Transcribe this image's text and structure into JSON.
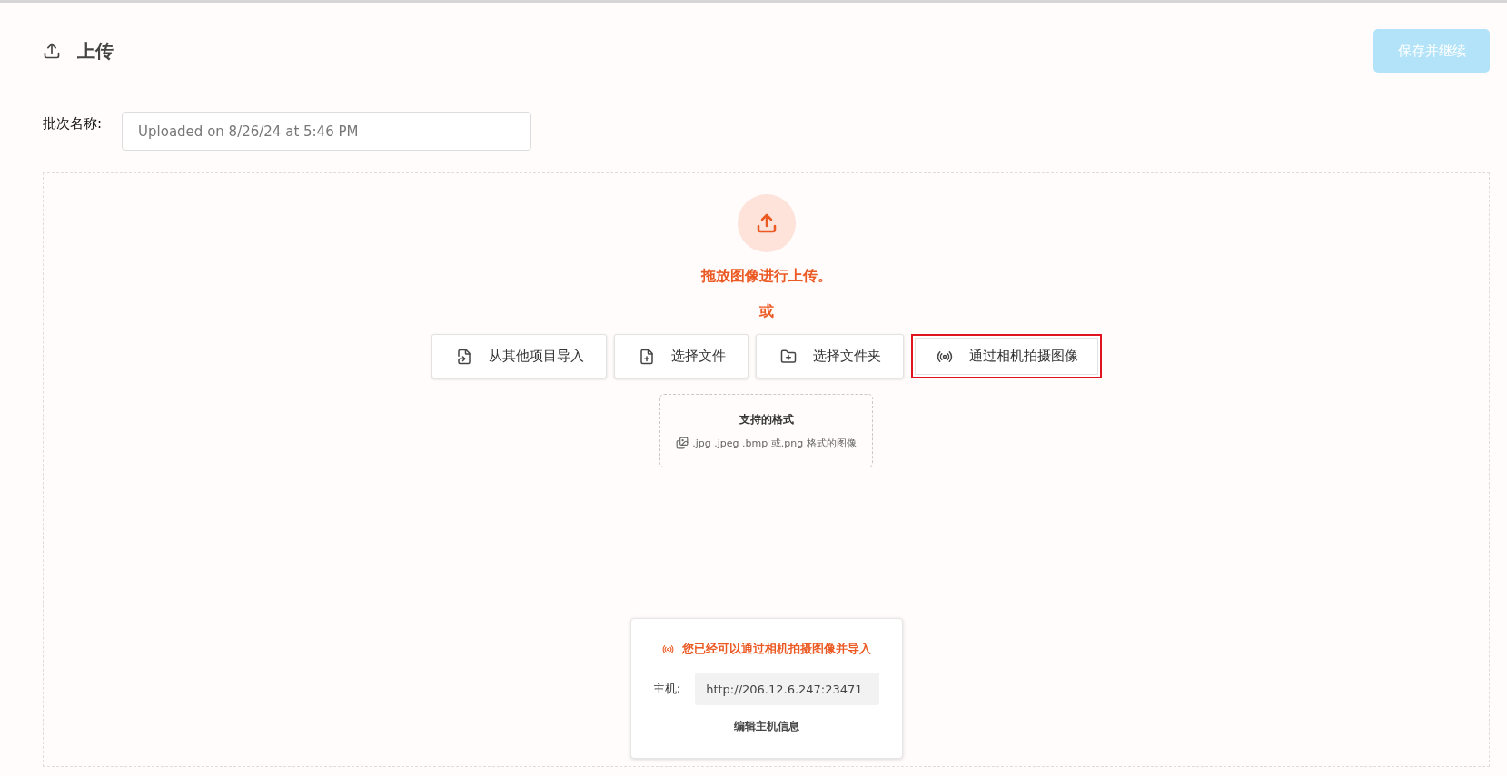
{
  "header": {
    "title": "上传",
    "save_button": {
      "label": "保存并继续",
      "disabled": true
    }
  },
  "batch": {
    "label": "批次名称:",
    "value": "Uploaded on 8/26/24 at 5:46 PM"
  },
  "dropzone": {
    "prompt": "拖放图像进行上传。",
    "or": "或",
    "buttons": [
      {
        "kind": "import",
        "label": "从其他项目导入",
        "highlighted": false
      },
      {
        "kind": "file",
        "label": "选择文件",
        "highlighted": false
      },
      {
        "kind": "folder",
        "label": "选择文件夹",
        "highlighted": false
      },
      {
        "kind": "camera",
        "label": "通过相机拍摄图像",
        "highlighted": true
      }
    ],
    "formats": {
      "title": "支持的格式",
      "text": ".jpg .jpeg .bmp 或.png 格式的图像"
    }
  },
  "camera_card": {
    "message": "您已经可以通过相机拍摄图像并导入",
    "host_label": "主机:",
    "host_value": "http://206.12.6.247:23471",
    "edit_link": "编辑主机信息"
  }
}
